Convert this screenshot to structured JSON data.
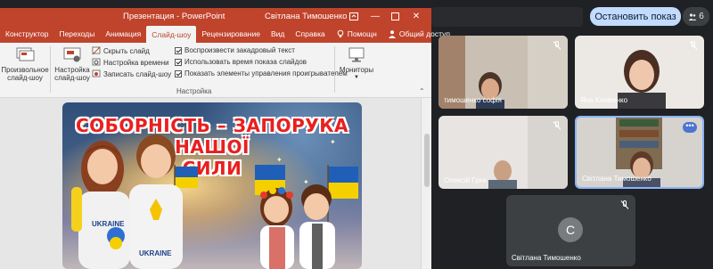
{
  "meet": {
    "stop_button": "Остановить показ",
    "people_count": "6",
    "participants": [
      {
        "name": "тимошенко софія"
      },
      {
        "name": "Яна Клименко"
      },
      {
        "name": "Олексій Грек"
      },
      {
        "name": "Світлана Тимошенко"
      },
      {
        "name": "Світлана Тимошенко",
        "initial": "С"
      }
    ]
  },
  "ppt": {
    "window_title": "Презентация - PowerPoint",
    "user": "Світлана Тимошенко",
    "tabs": [
      "Конструктор",
      "Переходы",
      "Анимация",
      "Слайд-шоу",
      "Рецензирование",
      "Вид",
      "Справка",
      "Помощн",
      "Общий доступ"
    ],
    "active_tab": "Слайд-шоу",
    "ribbon": {
      "custom_show": "Произвольное слайд-шоу",
      "setup_show": "Настройка слайд-шоу",
      "hide_slide": "Скрыть слайд",
      "rehearse": "Настройка времени",
      "record": "Записать слайд-шоу",
      "play_narration": "Воспроизвести закадровый текст",
      "use_timings": "Использовать время показа слайдов",
      "show_media_controls": "Показать элементы управления проигрывателем",
      "monitors": "Мониторы",
      "group_setup": "Настройка"
    },
    "slide": {
      "line1": "СОБОРНІСТЬ – ЗАПОРУКА",
      "line2": "НАШОЇ",
      "line3": "СИЛИ",
      "shirt_text_1": "UKRAINE",
      "shirt_text_2": "UKRAINE"
    }
  },
  "colors": {
    "ppt_accent": "#c0432c",
    "meet_bg": "#202124",
    "stop_button": "#c2dbff"
  }
}
